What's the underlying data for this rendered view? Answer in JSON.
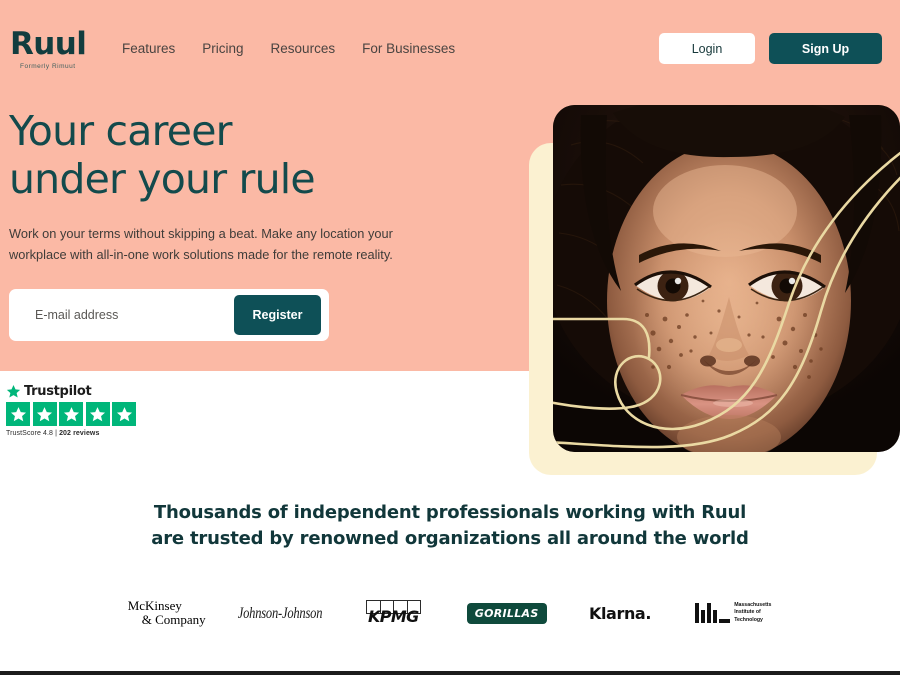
{
  "brand": {
    "name": "Ruul",
    "tagline": "Formerly Rimuut",
    "accent_teal": "#0E5057",
    "hero_peach": "#FBB9A5",
    "cream_card": "#FBF1D1",
    "swirl_gold": "#EADCA6",
    "trustpilot_green": "#00B67A"
  },
  "nav": {
    "links": [
      {
        "label": "Features"
      },
      {
        "label": "Pricing"
      },
      {
        "label": "Resources"
      },
      {
        "label": "For Businesses"
      }
    ],
    "login_label": "Login",
    "signup_label": "Sign Up"
  },
  "hero": {
    "title_line1": "Your career",
    "title_line2": "under your rule",
    "subtitle": "Work on your terms without skipping a beat. Make any location your workplace with all-in-one work solutions made for the remote reality.",
    "form": {
      "email_placeholder": "E-mail address",
      "email_value": "",
      "register_label": "Register"
    },
    "image_alt": "Portrait of a young woman with freckles, overlaid with gold line art"
  },
  "trustpilot": {
    "name": "Trustpilot",
    "stars": 5,
    "star_glyph": "star-icon",
    "score_text": "TrustScore 4.8",
    "separator": "|",
    "reviews_text": "202 reviews"
  },
  "orgs": {
    "title_line1": "Thousands of independent professionals working with Ruul",
    "title_line2": "are trusted by renowned organizations all around the world",
    "logos": [
      {
        "name": "mckinsey",
        "line1": "McKinsey",
        "line2": "& Company"
      },
      {
        "name": "johnson-and-johnson",
        "label": "Johnson-Johnson"
      },
      {
        "name": "kpmg",
        "label": "KPMG"
      },
      {
        "name": "gorillas",
        "label": "GORILLAS"
      },
      {
        "name": "klarna",
        "label": "Klarna."
      },
      {
        "name": "mit",
        "label": "MIT",
        "line1": "Massachusetts",
        "line2": "Institute of",
        "line3": "Technology"
      }
    ]
  }
}
